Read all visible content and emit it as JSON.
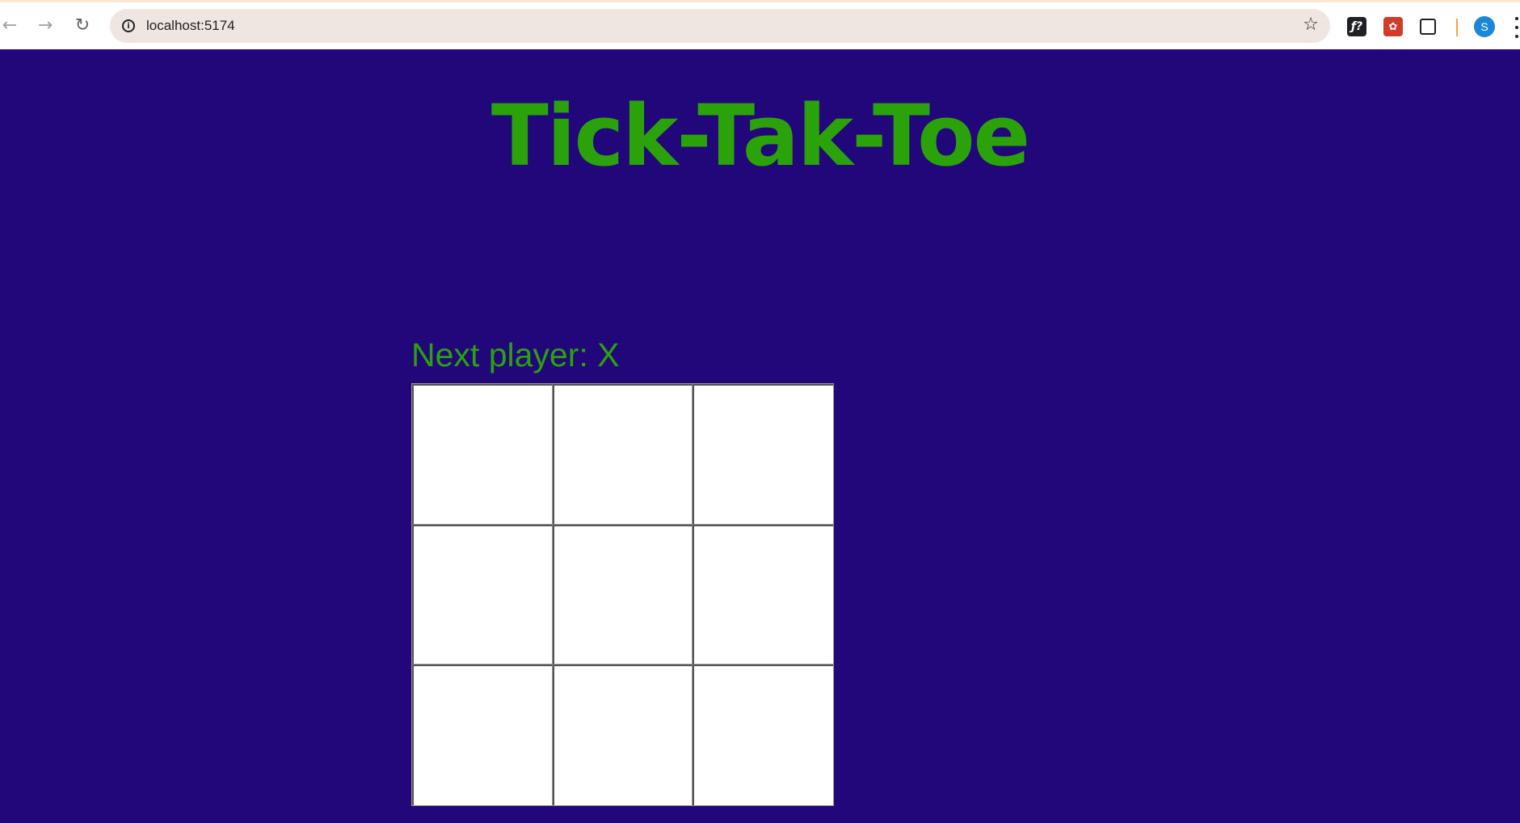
{
  "browser": {
    "url": "localhost:5174",
    "icons": {
      "back": "arrow-left-icon",
      "forward": "arrow-right-icon",
      "reload": "reload-icon",
      "site_info": "info-icon",
      "bookmark": "star-icon",
      "extension_fx": "function-icon",
      "extension_red": "extension-icon",
      "extensions_menu": "puzzle-icon",
      "menu": "kebab-menu-icon"
    },
    "extension_fx_glyph": "ƒ?",
    "extension_red_glyph": "✿",
    "profile_initial": "S",
    "colors": {
      "profile": "#1a87d8",
      "omnibox": "#efe6e1"
    }
  },
  "game": {
    "title": "Tick-Tak-Toe",
    "status": "Next player: X",
    "squares": [
      "",
      "",
      "",
      "",
      "",
      "",
      "",
      "",
      ""
    ],
    "colors": {
      "background": "#22077b",
      "text": "#2ba20a",
      "board": "#ffffff",
      "grid_lines": "#999999"
    }
  }
}
